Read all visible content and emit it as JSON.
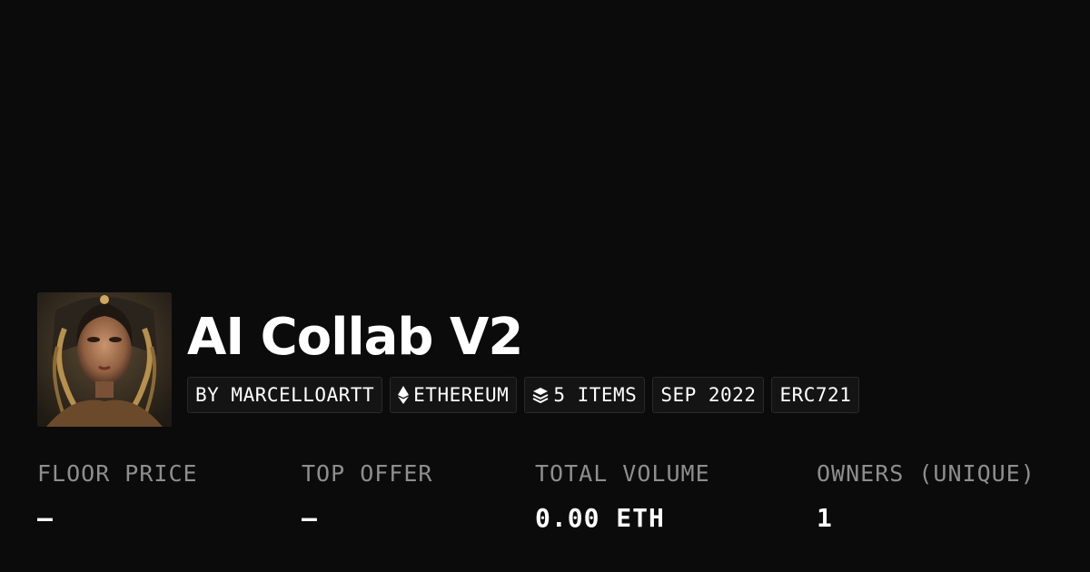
{
  "collection": {
    "name": "AI Collab V2",
    "avatar_alt": "collection-avatar"
  },
  "chips": {
    "creator": "BY MARCELLOARTT",
    "chain": "ETHEREUM",
    "items": "5 ITEMS",
    "date": "SEP 2022",
    "standard": "ERC721",
    "chain_icon": "ethereum-icon",
    "items_icon": "layers-icon"
  },
  "stats": {
    "floor_price": {
      "label": "FLOOR PRICE",
      "value": "—"
    },
    "top_offer": {
      "label": "TOP OFFER",
      "value": "—"
    },
    "total_volume": {
      "label": "TOTAL VOLUME",
      "value": "0.00 ETH"
    },
    "owners": {
      "label": "OWNERS (UNIQUE)",
      "value": "1"
    }
  },
  "colors": {
    "background": "#0b0b0b",
    "chip_background": "#141414",
    "label_gray": "#8e8e8e",
    "text": "#ffffff"
  }
}
